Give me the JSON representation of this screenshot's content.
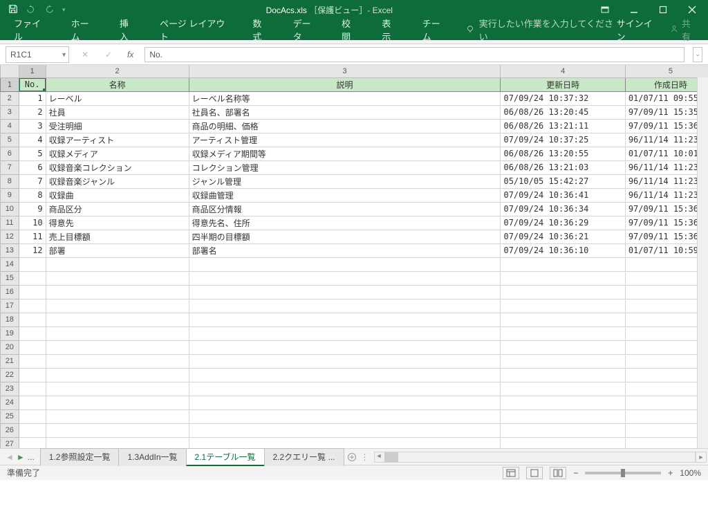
{
  "title": {
    "filename": "DocAcs.xls",
    "suffix": "［保護ビュー］- Excel"
  },
  "qat": {
    "save": "save-icon",
    "undo": "undo-icon",
    "redo": "redo-icon"
  },
  "win": {
    "restore": "restore-icon",
    "min": "minimize-icon",
    "max": "maximize-icon",
    "close": "close-icon"
  },
  "ribbon": {
    "tabs": [
      "ファイル",
      "ホーム",
      "挿入",
      "ページ レイアウト",
      "数式",
      "データ",
      "校閲",
      "表示",
      "チーム"
    ],
    "tellme": "実行したい作業を入力してください",
    "signin": "サインイン",
    "share": "共有"
  },
  "namebox": "R1C1",
  "formula": "No.",
  "columns": [
    "1",
    "2",
    "3",
    "4",
    "5"
  ],
  "headers": [
    "No.",
    "名称",
    "説明",
    "更新日時",
    "作成日時"
  ],
  "rows": [
    {
      "no": "1",
      "name": "レーベル",
      "desc": "レーベル名称等",
      "upd": "07/09/24 10:37:32",
      "crt": "01/07/11 09:55:"
    },
    {
      "no": "2",
      "name": "社員",
      "desc": "社員名、部署名",
      "upd": "06/08/26 13:20:45",
      "crt": "97/09/11 15:35:"
    },
    {
      "no": "3",
      "name": "受注明細",
      "desc": "商品の明細、価格",
      "upd": "06/08/26 13:21:11",
      "crt": "97/09/11 15:36:"
    },
    {
      "no": "4",
      "name": "収録アーティスト",
      "desc": "アーティスト管理",
      "upd": "07/09/24 10:37:25",
      "crt": "96/11/14 11:23:"
    },
    {
      "no": "5",
      "name": "収録メディア",
      "desc": "収録メディア期間等",
      "upd": "06/08/26 13:20:55",
      "crt": "01/07/11 10:01:"
    },
    {
      "no": "6",
      "name": "収録音楽コレクション",
      "desc": "コレクション管理",
      "upd": "06/08/26 13:21:03",
      "crt": "96/11/14 11:23:"
    },
    {
      "no": "7",
      "name": "収録音楽ジャンル",
      "desc": "ジャンル管理",
      "upd": "05/10/05 15:42:27",
      "crt": "96/11/14 11:23:"
    },
    {
      "no": "8",
      "name": "収録曲",
      "desc": "収録曲管理",
      "upd": "07/09/24 10:36:41",
      "crt": "96/11/14 11:23:"
    },
    {
      "no": "9",
      "name": "商品区分",
      "desc": "商品区分情報",
      "upd": "07/09/24 10:36:34",
      "crt": "97/09/11 15:36:"
    },
    {
      "no": "10",
      "name": "得意先",
      "desc": "得意先名、住所",
      "upd": "07/09/24 10:36:29",
      "crt": "97/09/11 15:36:"
    },
    {
      "no": "11",
      "name": "売上目標額",
      "desc": "四半期の目標額",
      "upd": "07/09/24 10:36:21",
      "crt": "97/09/11 15:36:"
    },
    {
      "no": "12",
      "name": "部署",
      "desc": "部署名",
      "upd": "07/09/24 10:36:10",
      "crt": "01/07/11 10:59:"
    }
  ],
  "empty_rows": 14,
  "sheets": {
    "scroll_more": "...",
    "tabs": [
      "1.2参照設定一覧",
      "1.3AddIn一覧",
      "2.1テーブル一覧",
      "2.2クエリー覧 ..."
    ],
    "active": 2
  },
  "status": {
    "left": "準備完了",
    "zoom": "100%"
  }
}
